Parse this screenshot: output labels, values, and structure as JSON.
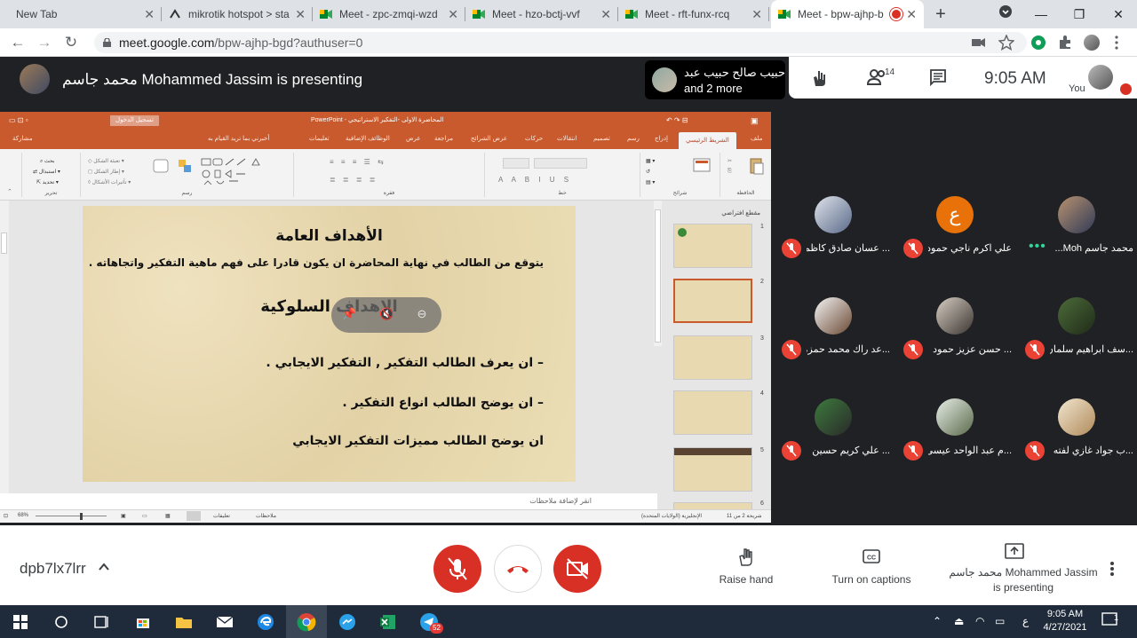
{
  "browser": {
    "tabs": [
      {
        "title": "New Tab"
      },
      {
        "title": "mikrotik hotspot > sta"
      },
      {
        "title": "Meet - zpc-zmqi-wzd"
      },
      {
        "title": "Meet - hzo-bctj-vvf"
      },
      {
        "title": "Meet - rft-funx-rcq"
      },
      {
        "title": "Meet - bpw-ajhp-b"
      }
    ],
    "url_host": "meet.google.com",
    "url_path": "/bpw-ajhp-bgd?authuser=0"
  },
  "meet": {
    "presenting_title": "محمد جاسم Mohammed Jassim is presenting",
    "others_name": "حبيب صالح حبيب عبد",
    "others_more": "and 2 more",
    "participant_count": "14",
    "time": "9:05 AM",
    "you_label": "You",
    "meeting_code": "dpb7lx7lrr",
    "raise_hand": "Raise hand",
    "captions": "Turn on captions",
    "presenting_line1": "محمد جاسم Mohammed Jassim",
    "presenting_line2": "is presenting"
  },
  "participants": [
    {
      "name": "محمد جاسم Moh...",
      "speaking": true
    },
    {
      "name": "علي اكرم ناجي حمود",
      "avatar_letter": "ع"
    },
    {
      "name": "... عسان صادق كاظم"
    },
    {
      "name": "...سف ابراهيم سلمان"
    },
    {
      "name": "... حسن عزيز حمود"
    },
    {
      "name": "...عد راك محمد حمزه"
    },
    {
      "name": "...ب جواد غازي لفته"
    },
    {
      "name": "...م عبد الواحد عيسى"
    },
    {
      "name": "... علي كريم حسين"
    }
  ],
  "ppt": {
    "title": "المحاضرة الاولى -التفكير الاستراتيجي - PowerPoint",
    "signin": "تسجيل الدخول",
    "tabs": [
      "ملف",
      "الشريط الرئيسي",
      "إدراج",
      "رسم",
      "تصميم",
      "انتقالات",
      "حركات",
      "عرض الشرائح",
      "مراجعة",
      "عرض",
      "الوظائف الإضافية",
      "تعليمات",
      "أخبرني بما تريد القيام به",
      "مشاركة"
    ],
    "groups": [
      "الحافظة",
      "شرائح",
      "خط",
      "فقرة",
      "رسم",
      "تحرير"
    ],
    "outline_label": "مقطع افتراضي",
    "slide": {
      "heading": "الأهداف العامة",
      "line1": "يتوقع من الطالب في نهاية المحاضرة ان يكون قادرا على فهم ماهية التفكير واتجاهاته .",
      "heading2": "الاهداف السلوكية",
      "b1": "–  ان يعرف الطالب التفكير , التفكير الايجابي .",
      "b2": "–  ان  يوضح الطالب انواع التفكير .",
      "b3": "ان يوضح  الطالب مميزات التفكير الايجابي"
    },
    "thumb_numbers": [
      "1",
      "2",
      "3",
      "4",
      "5",
      "6"
    ],
    "notes_placeholder": "انقر لإضافة ملاحظات",
    "status_slide": "شريحة 2 من 11",
    "status_lang": "الإنجليزية (الولايات المتحدة)",
    "status_notes": "ملاحظات",
    "status_comments": "تعليقات",
    "zoom": "68%"
  },
  "taskbar": {
    "time": "9:05 AM",
    "date": "4/27/2021",
    "lang": "ع",
    "telegram_badge": "52",
    "notif_badge": "1"
  },
  "colors": {
    "meet_red": "#d93025",
    "ppt_orange": "#c85a2e",
    "meet_dark": "#202124",
    "speaking_green": "#34d399"
  }
}
